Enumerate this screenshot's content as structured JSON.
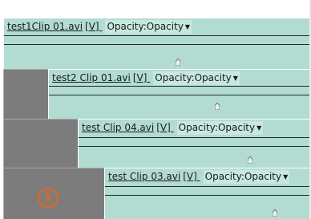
{
  "tracks": [
    {
      "clip_name": "test1Clip 01.avi",
      "type_tag": "[V]",
      "opacity_label": "Opacity:Opacity"
    },
    {
      "clip_name": "test2 Clip 01.avi",
      "type_tag": "[V]",
      "opacity_label": "Opacity:Opacity"
    },
    {
      "clip_name": "test Clip 04.avi",
      "type_tag": "[V]",
      "opacity_label": "Opacity:Opacity"
    },
    {
      "clip_name": "test Clip 03.avi",
      "type_tag": "[V]",
      "opacity_label": "Opacity:Opacity"
    }
  ],
  "annotation": {
    "label": "①"
  },
  "colors": {
    "clip_fill": "#b2dcd2",
    "track_gray": "#7c7c7c",
    "badge_orange": "#e8641c"
  },
  "icons": {
    "dropdown": "triangle-down-icon",
    "keyframe": "keyframe-marker-icon"
  }
}
